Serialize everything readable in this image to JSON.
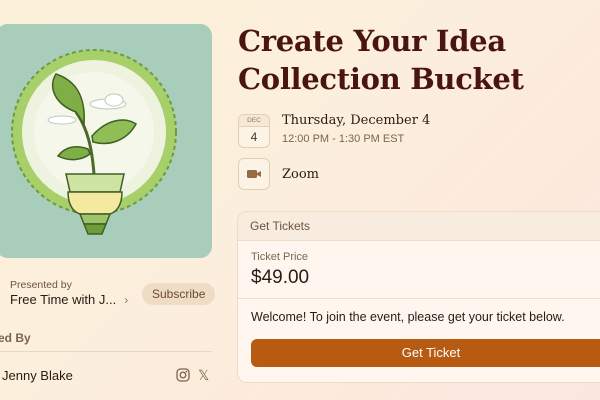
{
  "event": {
    "title": "Create Your Idea Collection Bucket",
    "date": {
      "month": "DEC",
      "day": "4",
      "full": "Thursday, December 4",
      "time": "12:00 PM - 1:30 PM EST"
    },
    "location": "Zoom"
  },
  "host": {
    "presented_label": "Presented by",
    "name": "Free Time with J...",
    "subscribe_label": "Subscribe",
    "hosted_label": "ed By",
    "person": "Jenny Blake"
  },
  "tickets": {
    "header": "Get Tickets",
    "price_label": "Ticket Price",
    "price": "$49.00",
    "message": "Welcome! To join the event, please get your ticket below.",
    "button_label": "Get Ticket"
  },
  "colors": {
    "accent": "#b85b12",
    "title": "#4a1410",
    "cover_bg": "#a9cdbb"
  },
  "icons": {
    "host_chevron": "chevron-right-icon",
    "location": "video-camera-icon",
    "social_1": "instagram-icon",
    "social_2": "x-icon"
  }
}
